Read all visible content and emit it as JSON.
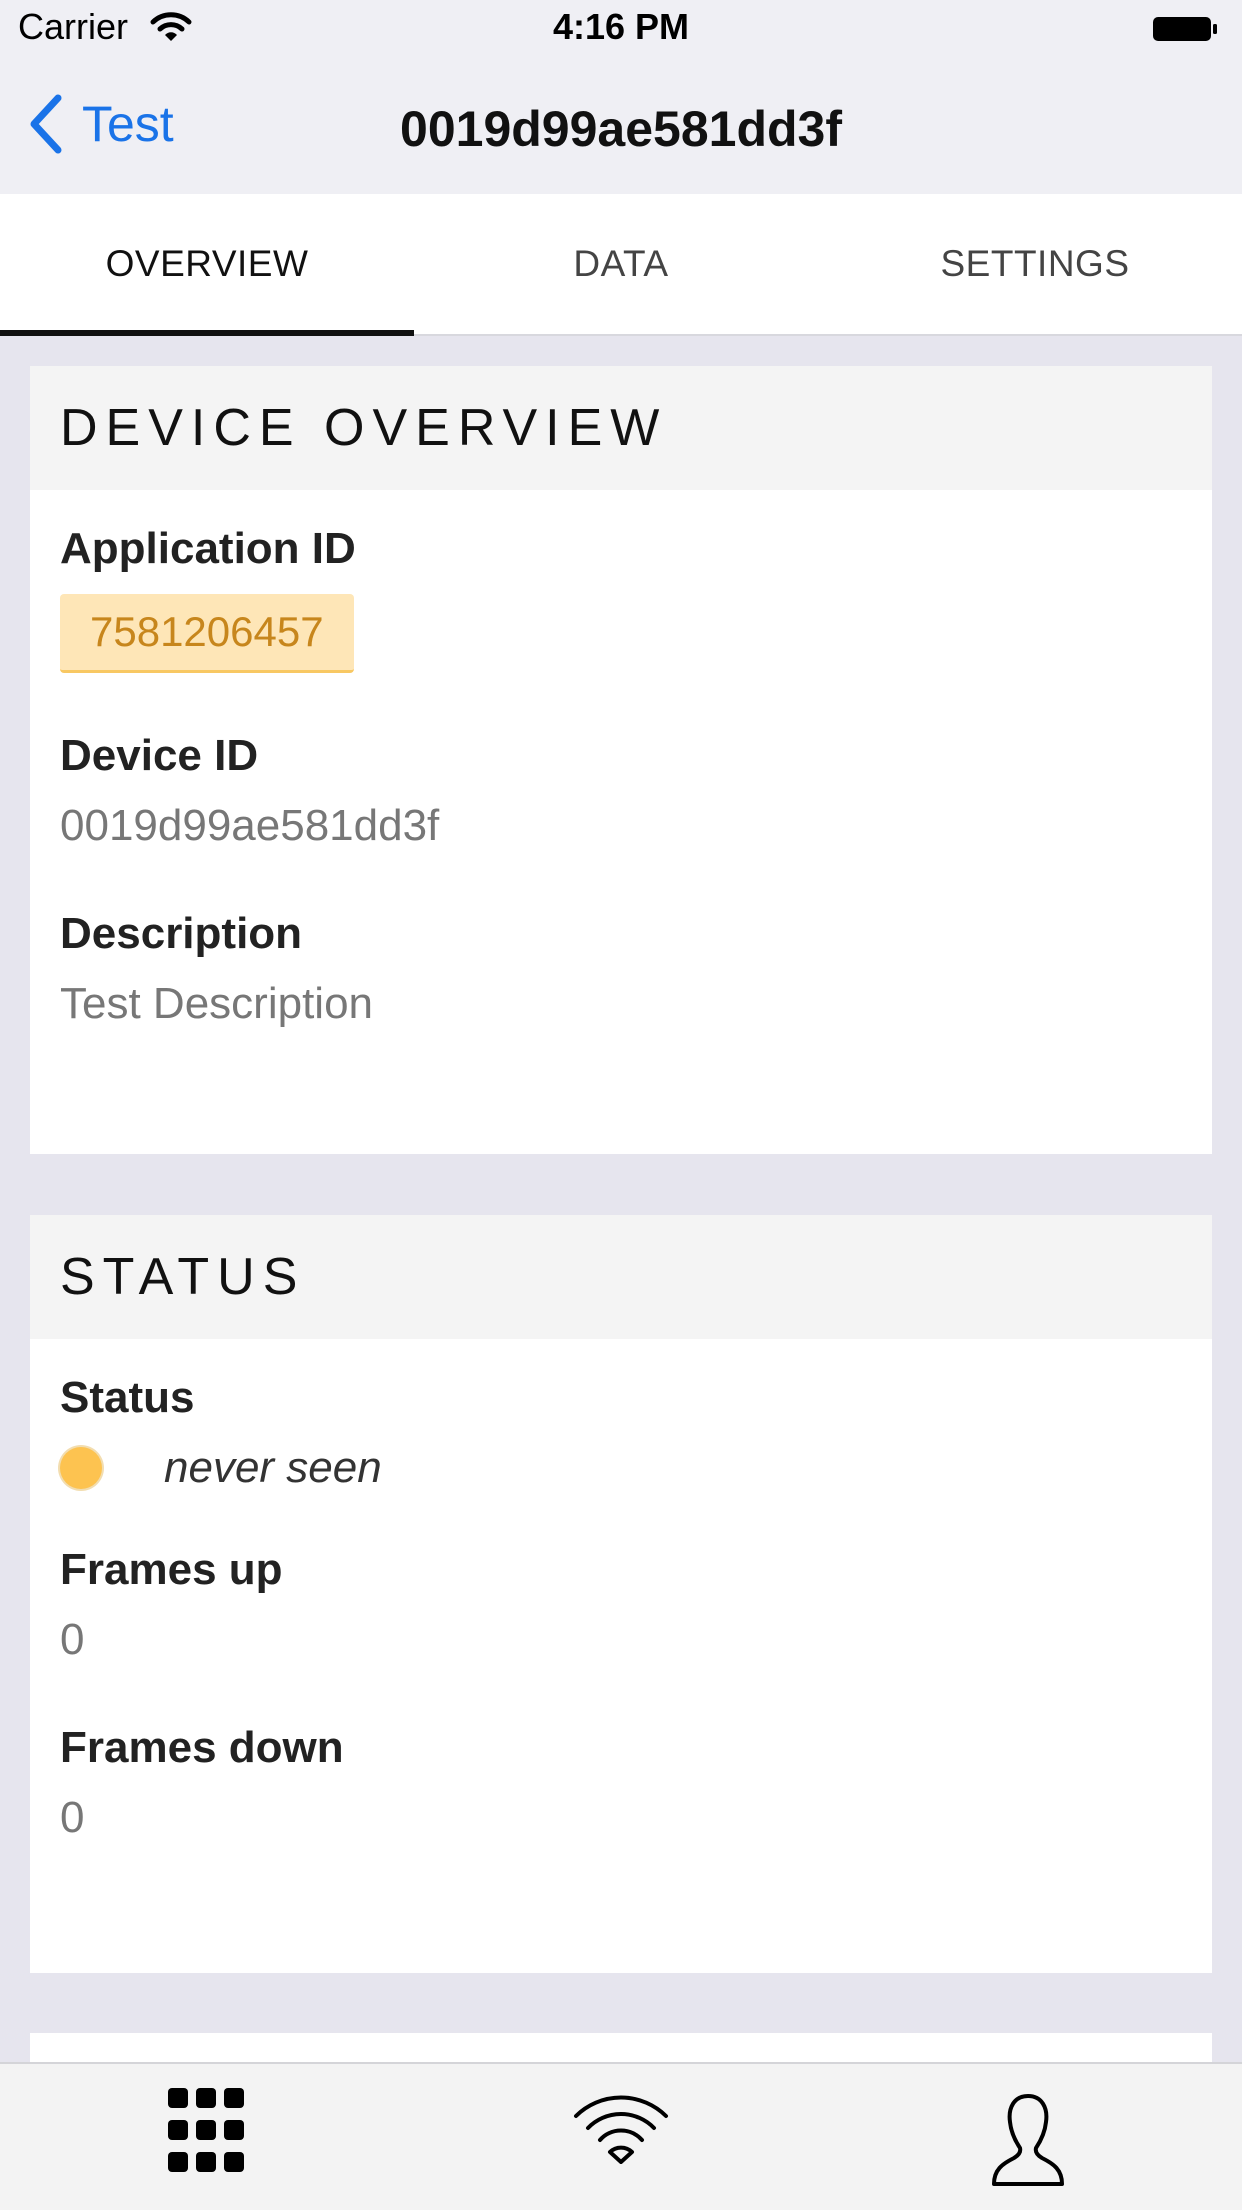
{
  "status_bar": {
    "carrier": "Carrier",
    "time": "4:16 PM"
  },
  "nav": {
    "back_label": "Test",
    "title": "0019d99ae581dd3f"
  },
  "tabs": [
    {
      "label": "OVERVIEW",
      "active": true
    },
    {
      "label": "DATA",
      "active": false
    },
    {
      "label": "SETTINGS",
      "active": false
    }
  ],
  "device_overview": {
    "header": "DEVICE OVERVIEW",
    "application_id_label": "Application ID",
    "application_id_value": "7581206457",
    "device_id_label": "Device ID",
    "device_id_value": "0019d99ae581dd3f",
    "description_label": "Description",
    "description_value": "Test Description"
  },
  "status": {
    "header": "STATUS",
    "status_label": "Status",
    "status_value": "never seen",
    "status_color": "#fdc350",
    "frames_up_label": "Frames up",
    "frames_up_value": "0",
    "frames_down_label": "Frames down",
    "frames_down_value": "0"
  },
  "tab_bar": {
    "items": [
      {
        "icon": "grid-icon"
      },
      {
        "icon": "wifi-icon"
      },
      {
        "icon": "person-icon"
      }
    ]
  }
}
